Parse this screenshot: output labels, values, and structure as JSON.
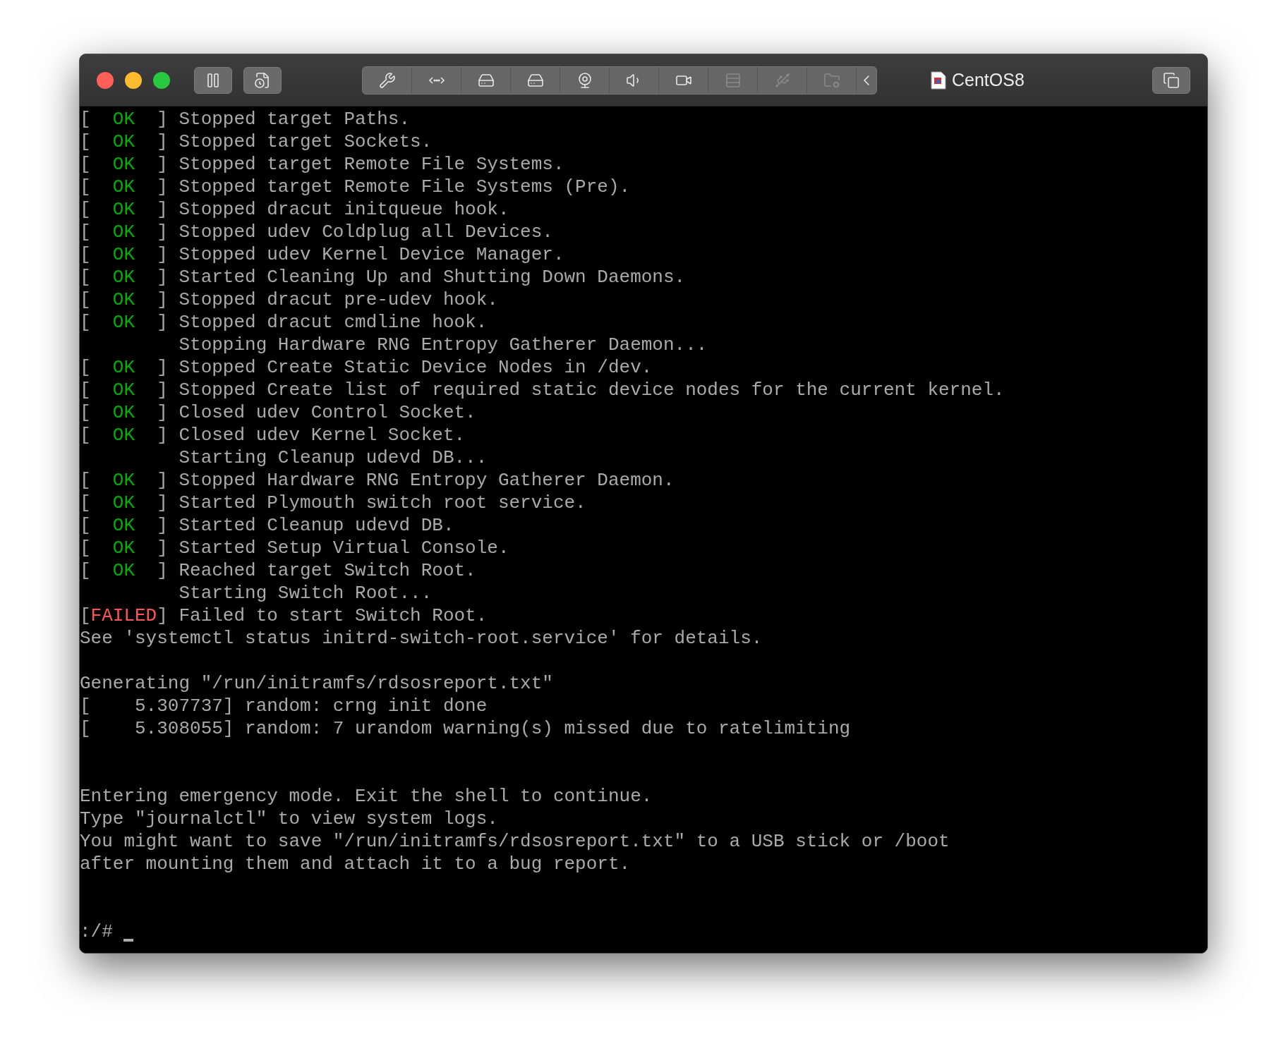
{
  "window": {
    "title": "CentOS8"
  },
  "toolbar": {
    "left": [
      {
        "kind": "pause",
        "disabled": false
      },
      {
        "kind": "snapshot",
        "disabled": false
      }
    ],
    "tools": [
      {
        "kind": "wrench",
        "disabled": false
      },
      {
        "kind": "arrows",
        "disabled": false
      },
      {
        "kind": "drive",
        "disabled": false
      },
      {
        "kind": "drive",
        "disabled": false
      },
      {
        "kind": "webcam",
        "disabled": false
      },
      {
        "kind": "speaker",
        "disabled": false
      },
      {
        "kind": "camera",
        "disabled": false
      },
      {
        "kind": "network",
        "disabled": true
      },
      {
        "kind": "usb",
        "disabled": true
      },
      {
        "kind": "folder",
        "disabled": true
      },
      {
        "kind": "collapse",
        "disabled": false
      }
    ],
    "right": [
      {
        "kind": "windows",
        "disabled": false
      }
    ]
  },
  "console": {
    "lines": [
      {
        "kind": "status",
        "prefix": "[",
        "status": "OK",
        "failed": false,
        "suffix": "]",
        "text": "Stopped target Paths."
      },
      {
        "kind": "status",
        "prefix": "[",
        "status": "OK",
        "failed": false,
        "suffix": "]",
        "text": "Stopped target Sockets."
      },
      {
        "kind": "status",
        "prefix": "[",
        "status": "OK",
        "failed": false,
        "suffix": "]",
        "text": "Stopped target Remote File Systems."
      },
      {
        "kind": "status",
        "prefix": "[",
        "status": "OK",
        "failed": false,
        "suffix": "]",
        "text": "Stopped target Remote File Systems (Pre)."
      },
      {
        "kind": "status",
        "prefix": "[",
        "status": "OK",
        "failed": false,
        "suffix": "]",
        "text": "Stopped dracut initqueue hook."
      },
      {
        "kind": "status",
        "prefix": "[",
        "status": "OK",
        "failed": false,
        "suffix": "]",
        "text": "Stopped udev Coldplug all Devices."
      },
      {
        "kind": "status",
        "prefix": "[",
        "status": "OK",
        "failed": false,
        "suffix": "]",
        "text": "Stopped udev Kernel Device Manager."
      },
      {
        "kind": "status",
        "prefix": "[",
        "status": "OK",
        "failed": false,
        "suffix": "]",
        "text": "Started Cleaning Up and Shutting Down Daemons."
      },
      {
        "kind": "status",
        "prefix": "[",
        "status": "OK",
        "failed": false,
        "suffix": "]",
        "text": "Stopped dracut pre-udev hook."
      },
      {
        "kind": "status",
        "prefix": "[",
        "status": "OK",
        "failed": false,
        "suffix": "]",
        "text": "Stopped dracut cmdline hook."
      },
      {
        "kind": "job",
        "text": "Stopping Hardware RNG Entropy Gatherer Daemon..."
      },
      {
        "kind": "status",
        "prefix": "[",
        "status": "OK",
        "failed": false,
        "suffix": "]",
        "text": "Stopped Create Static Device Nodes in /dev."
      },
      {
        "kind": "status",
        "prefix": "[",
        "status": "OK",
        "failed": false,
        "suffix": "]",
        "text": "Stopped Create list of required static device nodes for the current kernel."
      },
      {
        "kind": "status",
        "prefix": "[",
        "status": "OK",
        "failed": false,
        "suffix": "]",
        "text": "Closed udev Control Socket."
      },
      {
        "kind": "status",
        "prefix": "[",
        "status": "OK",
        "failed": false,
        "suffix": "]",
        "text": "Closed udev Kernel Socket."
      },
      {
        "kind": "job",
        "text": "Starting Cleanup udevd DB..."
      },
      {
        "kind": "status",
        "prefix": "[",
        "status": "OK",
        "failed": false,
        "suffix": "]",
        "text": "Stopped Hardware RNG Entropy Gatherer Daemon."
      },
      {
        "kind": "status",
        "prefix": "[",
        "status": "OK",
        "failed": false,
        "suffix": "]",
        "text": "Started Plymouth switch root service."
      },
      {
        "kind": "status",
        "prefix": "[",
        "status": "OK",
        "failed": false,
        "suffix": "]",
        "text": "Started Cleanup udevd DB."
      },
      {
        "kind": "status",
        "prefix": "[",
        "status": "OK",
        "failed": false,
        "suffix": "]",
        "text": "Started Setup Virtual Console."
      },
      {
        "kind": "status",
        "prefix": "[",
        "status": "OK",
        "failed": false,
        "suffix": "]",
        "text": "Reached target Switch Root."
      },
      {
        "kind": "job",
        "text": "Starting Switch Root..."
      },
      {
        "kind": "status",
        "prefix": "[",
        "status": "FAILED",
        "failed": true,
        "suffix": "]",
        "text": "Failed to start Switch Root."
      },
      {
        "kind": "plain",
        "text": "See 'systemctl status initrd-switch-root.service' for details."
      },
      {
        "kind": "blank"
      },
      {
        "kind": "plain",
        "text": "Generating \"/run/initramfs/rdsosreport.txt\""
      },
      {
        "kind": "plain",
        "text": "[    5.307737] random: crng init done"
      },
      {
        "kind": "plain",
        "text": "[    5.308055] random: 7 urandom warning(s) missed due to ratelimiting"
      },
      {
        "kind": "blank"
      },
      {
        "kind": "blank"
      },
      {
        "kind": "plain",
        "text": "Entering emergency mode. Exit the shell to continue."
      },
      {
        "kind": "plain",
        "text": "Type \"journalctl\" to view system logs."
      },
      {
        "kind": "plain",
        "text": "You might want to save \"/run/initramfs/rdsosreport.txt\" to a USB stick or /boot"
      },
      {
        "kind": "plain",
        "text": "after mounting them and attach it to a bug report."
      },
      {
        "kind": "blank"
      },
      {
        "kind": "blank"
      },
      {
        "kind": "prompt",
        "text": ":/#"
      }
    ]
  }
}
